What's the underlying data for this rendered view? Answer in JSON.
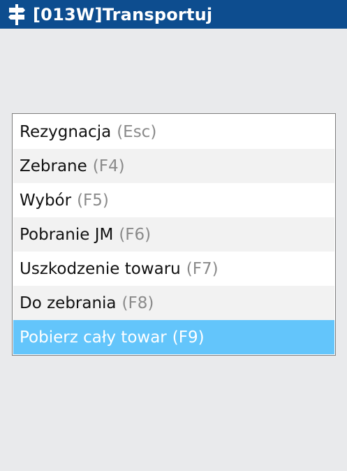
{
  "window": {
    "title": "[013W]Transportuj",
    "icon": "signpost-icon"
  },
  "menu": {
    "items": [
      {
        "label": "Rezygnacja",
        "key": "(Esc)"
      },
      {
        "label": "Zebrane",
        "key": "(F4)"
      },
      {
        "label": "Wybór",
        "key": "(F5)"
      },
      {
        "label": "Pobranie JM",
        "key": "(F6)"
      },
      {
        "label": "Uszkodzenie towaru",
        "key": "(F7)"
      },
      {
        "label": "Do zebrania",
        "key": "(F8)"
      },
      {
        "label": "Pobierz cały towar",
        "key": "(F9)"
      }
    ],
    "selected_label": "Pobierz cały towar"
  },
  "colors": {
    "titlebar": "#0d4d8f",
    "selected": "#63c5fb",
    "background": "#e9eaec",
    "shortcut": "#8a8a8a"
  }
}
